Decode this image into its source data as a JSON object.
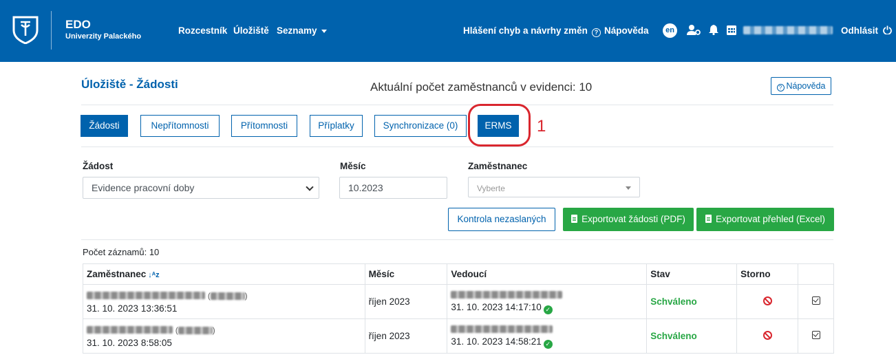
{
  "header": {
    "brand_title": "EDO",
    "brand_subtitle": "Univerzity Palackého",
    "nav": [
      "Rozcestník",
      "Úložiště",
      "Seznamy"
    ],
    "report_link": "Hlášení chyb a návrhy změn",
    "help_link": "Nápověda",
    "language": "en",
    "logout": "Odhlásit",
    "colors": {
      "bar": "#0062ad"
    }
  },
  "page": {
    "title": "Úložiště - Žádosti",
    "employee_count_text": "Aktuální počet zaměstnanců v evidenci: 10",
    "help_button": "Nápověda"
  },
  "tabs": [
    {
      "label": "Žádosti",
      "active": true
    },
    {
      "label": "Nepřítomnosti"
    },
    {
      "label": "Přítomnosti"
    },
    {
      "label": "Příplatky"
    },
    {
      "label": "Synchronizace (0)"
    },
    {
      "label": "ERMS"
    }
  ],
  "annotation": {
    "number": "1",
    "color": "#d9262e"
  },
  "filters": {
    "request_label": "Žádost",
    "request_value": "Evidence pracovní doby",
    "month_label": "Měsíc",
    "month_value": "10.2023",
    "employee_label": "Zaměstnanec",
    "employee_placeholder": "Vyberte"
  },
  "actions": {
    "check_unsent": "Kontrola nezaslaných",
    "export_pdf": "Exportovat žádosti (PDF)",
    "export_excel": "Exportovat přehled (Excel)"
  },
  "records_count": "Počet záznamů: 10",
  "table": {
    "headers": [
      "Zaměstnanec",
      "Měsíc",
      "Vedoucí",
      "Stav",
      "Storno",
      ""
    ],
    "rows": [
      {
        "employee_time": "31. 10. 2023 13:36:51",
        "month": "říjen 2023",
        "manager_time": "31. 10. 2023 14:17:10",
        "status": "Schváleno"
      },
      {
        "employee_time": "31. 10. 2023 8:58:05",
        "month": "říjen 2023",
        "manager_time": "31. 10. 2023 14:58:21",
        "status": "Schváleno"
      }
    ]
  }
}
